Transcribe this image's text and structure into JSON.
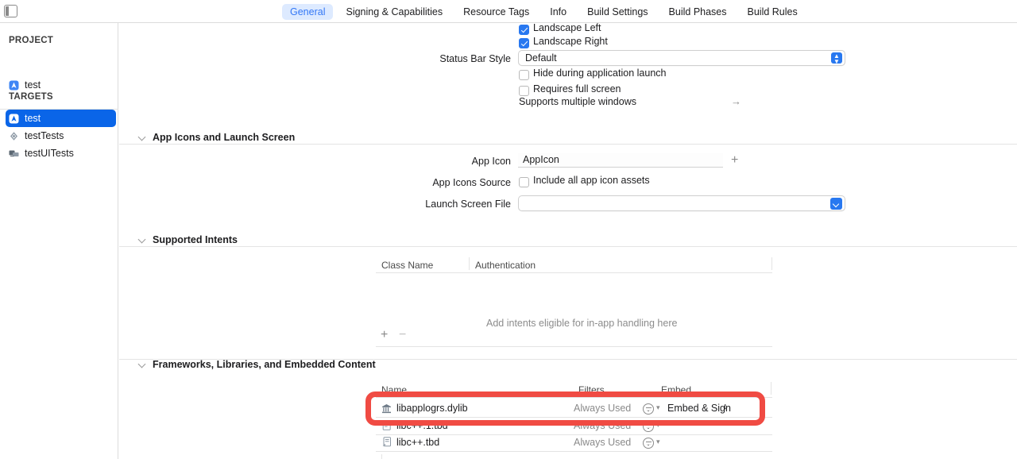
{
  "window": {
    "sidebar_toggle_name": "sidebar-toggle-icon"
  },
  "tabs": [
    {
      "label": "General",
      "active": true
    },
    {
      "label": "Signing & Capabilities",
      "active": false
    },
    {
      "label": "Resource Tags",
      "active": false
    },
    {
      "label": "Info",
      "active": false
    },
    {
      "label": "Build Settings",
      "active": false
    },
    {
      "label": "Build Phases",
      "active": false
    },
    {
      "label": "Build Rules",
      "active": false
    }
  ],
  "sidebar": {
    "project_header": "PROJECT",
    "project_items": [
      {
        "label": "test",
        "icon": "xcode-project-icon",
        "selected": false
      }
    ],
    "targets_header": "TARGETS",
    "target_items": [
      {
        "label": "test",
        "icon": "app-target-icon",
        "selected": true
      },
      {
        "label": "testTests",
        "icon": "unit-test-target-icon",
        "selected": false
      },
      {
        "label": "testUITests",
        "icon": "ui-test-target-icon",
        "selected": false
      }
    ]
  },
  "deployment": {
    "landscape_left": {
      "label": "Landscape Left",
      "checked": true
    },
    "landscape_right": {
      "label": "Landscape Right",
      "checked": true
    },
    "status_bar_style_label": "Status Bar Style",
    "status_bar_style_value": "Default",
    "hide_during_launch": {
      "label": "Hide during application launch",
      "checked": false
    },
    "requires_full_screen": {
      "label": "Requires full screen",
      "checked": false
    },
    "supports_multiple_windows": "Supports multiple windows"
  },
  "app_icons": {
    "section_title": "App Icons and Launch Screen",
    "app_icon_label": "App Icon",
    "app_icon_value": "AppIcon",
    "add_button": "+",
    "app_icons_source_label": "App Icons Source",
    "include_all_assets": {
      "label": "Include all app icon assets",
      "checked": false
    },
    "launch_screen_label": "Launch Screen File",
    "launch_screen_value": ""
  },
  "supported_intents": {
    "section_title": "Supported Intents",
    "columns": [
      "Class Name",
      "Authentication"
    ],
    "empty_text": "Add intents eligible for in-app handling here",
    "add_label": "+",
    "remove_label": "−"
  },
  "frameworks": {
    "section_title": "Frameworks, Libraries, and Embedded Content",
    "columns": [
      "Name",
      "Filters",
      "Embed"
    ],
    "rows": [
      {
        "name": "libapplogrs.dylib",
        "icon": "library-icon",
        "filter": "Always Used",
        "embed": "Embed & Sign",
        "has_embed_popup": true,
        "highlighted": true
      },
      {
        "name": "libc++.1.tbd",
        "icon": "tbd-document-icon",
        "filter": "Always Used",
        "embed": "",
        "has_embed_popup": false,
        "highlighted": false
      },
      {
        "name": "libc++.tbd",
        "icon": "tbd-document-icon",
        "filter": "Always Used",
        "embed": "",
        "has_embed_popup": false,
        "highlighted": false
      }
    ]
  },
  "colors": {
    "accent_blue": "#2878f0",
    "selection_blue": "#0a65e8",
    "tab_active_bg": "#ddeaff",
    "tab_active_fg": "#3478f6",
    "annotation_red": "#f04b43",
    "muted_text": "#8a8a8a"
  }
}
